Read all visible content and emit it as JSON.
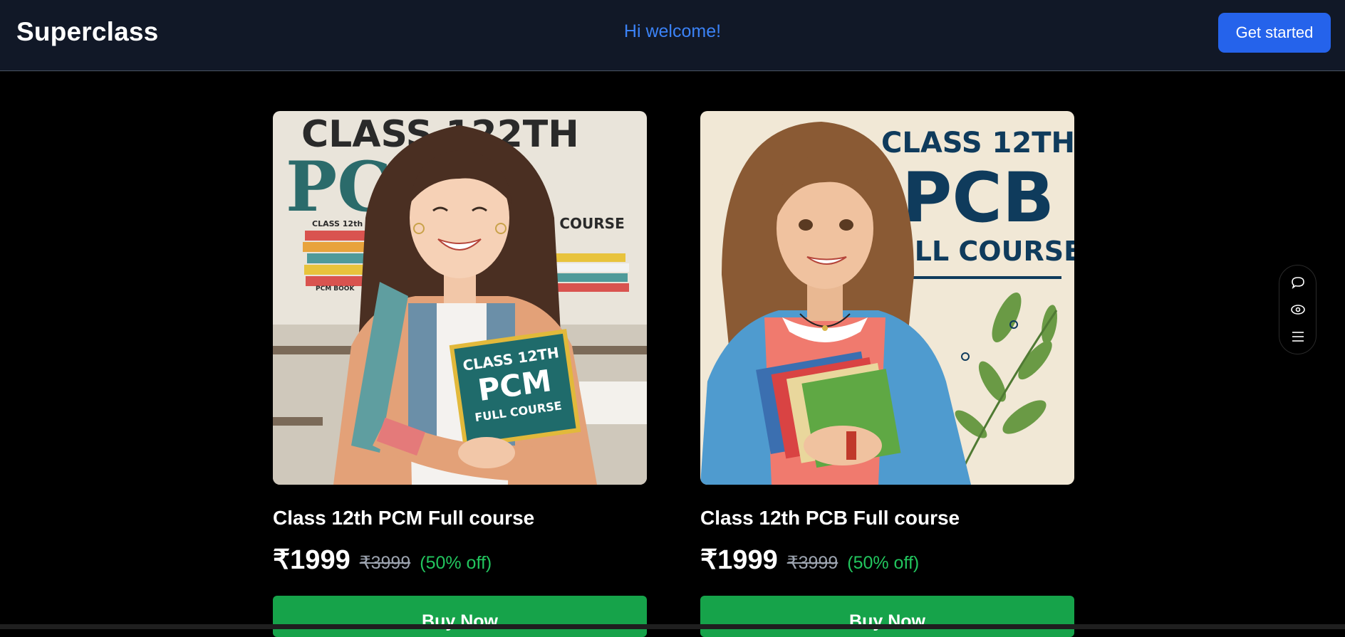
{
  "header": {
    "logo": "Superclass",
    "welcome": "Hi welcome!",
    "cta_label": "Get started"
  },
  "courses": [
    {
      "title": "Class 12th PCM Full course",
      "price": "₹1999",
      "original_price": "₹3999",
      "discount": "(50% off)",
      "buy_label": "Buy Now",
      "image_text": {
        "line1": "CLASS 122TH",
        "line2": "PCM",
        "line3": "FULL COURSE",
        "book_line1": "CLASS 12TH",
        "book_line2": "PCM",
        "book_line3": "FULL COURSE",
        "shelf_label": "CLASS 12th",
        "shelf_label2": "PCM BOOK"
      }
    },
    {
      "title": "Class 12th PCB Full course",
      "price": "₹1999",
      "original_price": "₹3999",
      "discount": "(50% off)",
      "buy_label": "Buy Now",
      "image_text": {
        "line1": "CLASS 12TH",
        "line2": "PCB",
        "line3": "FULL COURSE"
      }
    }
  ],
  "side_toolbar": {
    "icons": [
      "comment-icon",
      "eye-icon",
      "menu-icon"
    ]
  },
  "colors": {
    "header_bg": "#111827",
    "page_bg": "#000000",
    "accent_blue": "#2563eb",
    "welcome_blue": "#3b82f6",
    "buy_green": "#16a34a",
    "discount_green": "#22c55e",
    "old_price_gray": "#9ca3af"
  }
}
